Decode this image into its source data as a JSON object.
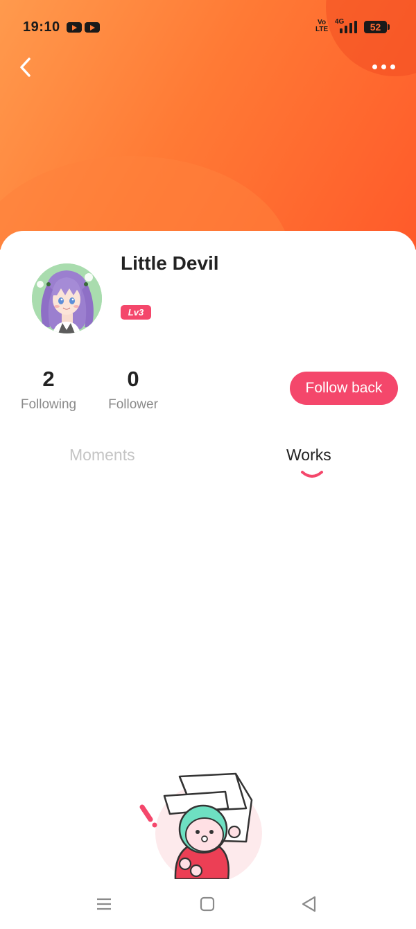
{
  "status_bar": {
    "time": "19:10",
    "notification_icons": [
      "youtube-icon",
      "youtube-icon"
    ],
    "volte_line1": "Vo",
    "volte_line2": "LTE",
    "network": "4G",
    "battery": "52"
  },
  "header": {
    "back_icon": "chevron-left-icon",
    "more_icon": "more-dots-icon"
  },
  "profile": {
    "name": "Little Devil",
    "level": "Lv3"
  },
  "stats": {
    "following_count": "2",
    "following_label": "Following",
    "follower_count": "0",
    "follower_label": "Follower"
  },
  "actions": {
    "follow_back_label": "Follow back"
  },
  "tabs": [
    {
      "label": "Moments",
      "active": false
    },
    {
      "label": "Works",
      "active": true
    }
  ],
  "colors": {
    "accent": "#f4476b",
    "banner_start": "#ff9a4d",
    "banner_end": "#ff5a2a",
    "inactive_tab": "#c4c4c4"
  },
  "nav_bar": {
    "icons": [
      "menu-icon",
      "home-square-icon",
      "back-triangle-icon"
    ]
  }
}
